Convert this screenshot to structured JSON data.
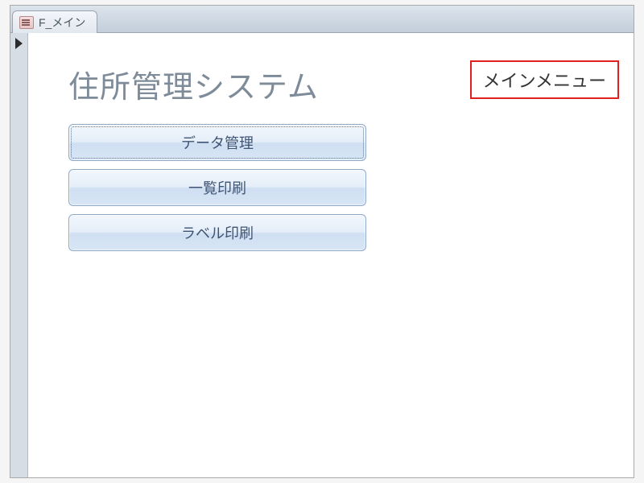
{
  "tab": {
    "title": "F_メイン"
  },
  "form": {
    "heading": "住所管理システム",
    "buttons": [
      {
        "label": "データ管理"
      },
      {
        "label": "一覧印刷"
      },
      {
        "label": "ラベル印刷"
      }
    ]
  },
  "callout": {
    "text": "メインメニュー"
  }
}
